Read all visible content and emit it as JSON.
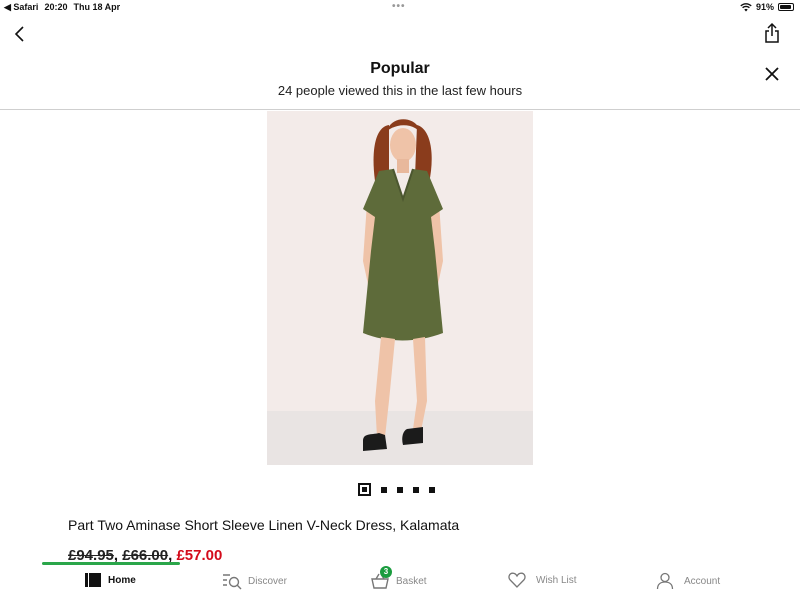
{
  "status_bar": {
    "back_app": "◀ Safari",
    "time": "20:20",
    "date": "Thu 18 Apr",
    "battery": "91%",
    "battery_level": 0.91
  },
  "header": {
    "title": "Popular",
    "subtitle": "24 people viewed this in the last few hours"
  },
  "carousel": {
    "count": 5,
    "active_index": 0
  },
  "product": {
    "name": "Part Two Aminase Short Sleeve Linen V-Neck Dress, Kalamata",
    "original_price": "£94.95",
    "previous_price": "£66.00",
    "sale_price": "£57.00",
    "separator": ", ",
    "sale_color": "#d40b1b"
  },
  "tabbar": {
    "items": [
      {
        "label": "Home",
        "icon": "home-icon",
        "active": true
      },
      {
        "label": "Discover",
        "icon": "discover-icon",
        "active": false
      },
      {
        "label": "Basket",
        "icon": "basket-icon",
        "active": false,
        "badge": "3"
      },
      {
        "label": "Wish List",
        "icon": "heart-icon",
        "active": false
      },
      {
        "label": "Account",
        "icon": "account-icon",
        "active": false
      }
    ]
  }
}
